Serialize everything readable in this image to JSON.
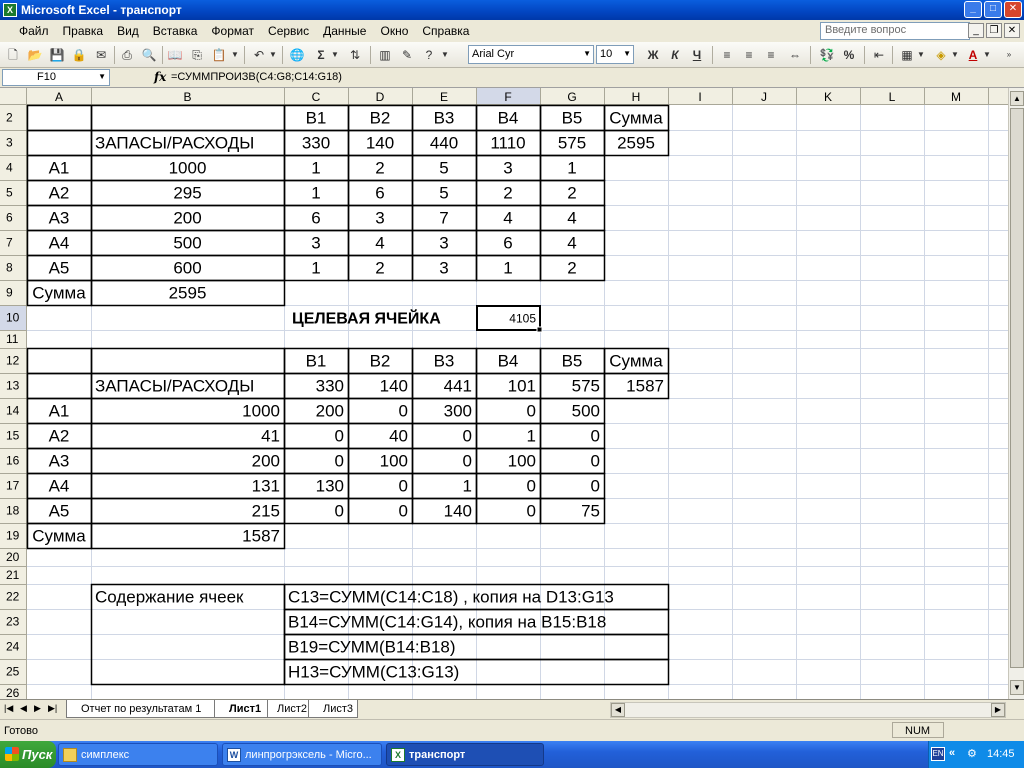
{
  "window": {
    "title": "Microsoft Excel - транспорт",
    "app_icon": "excel-icon",
    "buttons": {
      "minimize": "_",
      "maximize": "□",
      "close": "✕"
    }
  },
  "menu": {
    "items": [
      "Файл",
      "Правка",
      "Вид",
      "Вставка",
      "Формат",
      "Сервис",
      "Данные",
      "Окно",
      "Справка"
    ],
    "ask_placeholder": "Введите вопрос"
  },
  "toolbar": {
    "font_name": "Arial Cyr",
    "font_size": "10",
    "bold": "Ж",
    "italic": "К",
    "underline": "Ч"
  },
  "formula_bar": {
    "name_box": "F10",
    "fx": "fx",
    "formula": "=СУММПРОИЗВ(C4:G8;C14:G18)"
  },
  "sheet": {
    "col_headers": [
      "A",
      "B",
      "C",
      "D",
      "E",
      "F",
      "G",
      "H",
      "I",
      "J",
      "K",
      "L",
      "M"
    ],
    "row_numbers": [
      "2",
      "3",
      "4",
      "5",
      "6",
      "7",
      "8",
      "9",
      "10",
      "11",
      "12",
      "13",
      "14",
      "15",
      "16",
      "17",
      "18",
      "19",
      "20",
      "21",
      "22",
      "23",
      "24",
      "25",
      "26"
    ],
    "selected_col": "F",
    "selected_row": "10",
    "cells": [
      [
        "2",
        "C",
        "В1"
      ],
      [
        "2",
        "D",
        "В2"
      ],
      [
        "2",
        "E",
        "В3"
      ],
      [
        "2",
        "F",
        "В4"
      ],
      [
        "2",
        "G",
        "В5"
      ],
      [
        "2",
        "H",
        "Сумма"
      ],
      [
        "3",
        "B",
        "ЗАПАСЫ/РАСХОДЫ"
      ],
      [
        "3",
        "C",
        "330"
      ],
      [
        "3",
        "D",
        "140"
      ],
      [
        "3",
        "E",
        "440"
      ],
      [
        "3",
        "F",
        "1110"
      ],
      [
        "3",
        "G",
        "575"
      ],
      [
        "3",
        "H",
        "2595"
      ],
      [
        "4",
        "A",
        "А1"
      ],
      [
        "4",
        "B",
        "1000"
      ],
      [
        "4",
        "C",
        "1"
      ],
      [
        "4",
        "D",
        "2"
      ],
      [
        "4",
        "E",
        "5"
      ],
      [
        "4",
        "F",
        "3"
      ],
      [
        "4",
        "G",
        "1"
      ],
      [
        "5",
        "A",
        "А2"
      ],
      [
        "5",
        "B",
        "295"
      ],
      [
        "5",
        "C",
        "1"
      ],
      [
        "5",
        "D",
        "6"
      ],
      [
        "5",
        "E",
        "5"
      ],
      [
        "5",
        "F",
        "2"
      ],
      [
        "5",
        "G",
        "2"
      ],
      [
        "6",
        "A",
        "А3"
      ],
      [
        "6",
        "B",
        "200"
      ],
      [
        "6",
        "C",
        "6"
      ],
      [
        "6",
        "D",
        "3"
      ],
      [
        "6",
        "E",
        "7"
      ],
      [
        "6",
        "F",
        "4"
      ],
      [
        "6",
        "G",
        "4"
      ],
      [
        "7",
        "A",
        "А4"
      ],
      [
        "7",
        "B",
        "500"
      ],
      [
        "7",
        "C",
        "3"
      ],
      [
        "7",
        "D",
        "4"
      ],
      [
        "7",
        "E",
        "3"
      ],
      [
        "7",
        "F",
        "6"
      ],
      [
        "7",
        "G",
        "4"
      ],
      [
        "8",
        "A",
        "А5"
      ],
      [
        "8",
        "B",
        "600"
      ],
      [
        "8",
        "C",
        "1"
      ],
      [
        "8",
        "D",
        "2"
      ],
      [
        "8",
        "E",
        "3"
      ],
      [
        "8",
        "F",
        "1"
      ],
      [
        "8",
        "G",
        "2"
      ],
      [
        "9",
        "A",
        "Сумма"
      ],
      [
        "9",
        "B",
        "2595"
      ],
      [
        "10",
        "C",
        "ЦЕЛЕВАЯ ЯЧЕЙКА"
      ],
      [
        "10",
        "F",
        "4105"
      ],
      [
        "12",
        "C",
        "В1"
      ],
      [
        "12",
        "D",
        "В2"
      ],
      [
        "12",
        "E",
        "В3"
      ],
      [
        "12",
        "F",
        "В4"
      ],
      [
        "12",
        "G",
        "В5"
      ],
      [
        "12",
        "H",
        "Сумма"
      ],
      [
        "13",
        "B",
        "ЗАПАСЫ/РАСХОДЫ"
      ],
      [
        "13",
        "C",
        "330"
      ],
      [
        "13",
        "D",
        "140"
      ],
      [
        "13",
        "E",
        "441"
      ],
      [
        "13",
        "F",
        "101"
      ],
      [
        "13",
        "G",
        "575"
      ],
      [
        "13",
        "H",
        "1587"
      ],
      [
        "14",
        "A",
        "А1"
      ],
      [
        "14",
        "B",
        "1000"
      ],
      [
        "14",
        "C",
        "200"
      ],
      [
        "14",
        "D",
        "0"
      ],
      [
        "14",
        "E",
        "300"
      ],
      [
        "14",
        "F",
        "0"
      ],
      [
        "14",
        "G",
        "500"
      ],
      [
        "15",
        "A",
        "А2"
      ],
      [
        "15",
        "B",
        "41"
      ],
      [
        "15",
        "C",
        "0"
      ],
      [
        "15",
        "D",
        "40"
      ],
      [
        "15",
        "E",
        "0"
      ],
      [
        "15",
        "F",
        "1"
      ],
      [
        "15",
        "G",
        "0"
      ],
      [
        "16",
        "A",
        "А3"
      ],
      [
        "16",
        "B",
        "200"
      ],
      [
        "16",
        "C",
        "0"
      ],
      [
        "16",
        "D",
        "100"
      ],
      [
        "16",
        "E",
        "0"
      ],
      [
        "16",
        "F",
        "100"
      ],
      [
        "16",
        "G",
        "0"
      ],
      [
        "17",
        "A",
        "А4"
      ],
      [
        "17",
        "B",
        "131"
      ],
      [
        "17",
        "C",
        "130"
      ],
      [
        "17",
        "D",
        "0"
      ],
      [
        "17",
        "E",
        "1"
      ],
      [
        "17",
        "F",
        "0"
      ],
      [
        "17",
        "G",
        "0"
      ],
      [
        "18",
        "A",
        "А5"
      ],
      [
        "18",
        "B",
        "215"
      ],
      [
        "18",
        "C",
        "0"
      ],
      [
        "18",
        "D",
        "0"
      ],
      [
        "18",
        "E",
        "140"
      ],
      [
        "18",
        "F",
        "0"
      ],
      [
        "18",
        "G",
        "75"
      ],
      [
        "19",
        "A",
        "Сумма"
      ],
      [
        "19",
        "B",
        "1587"
      ],
      [
        "22",
        "B",
        "Содержание ячеек"
      ],
      [
        "22",
        "C",
        "C13=СУММ(C14:C18) , копия на D13:G13"
      ],
      [
        "23",
        "C",
        "B14=СУММ(C14:G14), копия на B15:B18"
      ],
      [
        "24",
        "C",
        "B19=СУММ(B14:B18)"
      ],
      [
        "25",
        "C",
        "H13=СУММ(C13:G13)"
      ]
    ]
  },
  "sheet_tabs": [
    "Отчет по результатам 1",
    "Лист1",
    "Лист2",
    "Лист3"
  ],
  "active_tab": "Лист1",
  "status": {
    "ready": "Готово",
    "num": "NUM"
  },
  "taskbar": {
    "start": "Пуск",
    "tasks": [
      "симплекс",
      "линпрогрэксель - Micro...",
      "транспорт"
    ],
    "active_task": "транспорт",
    "lang": "EN",
    "chevron": "«",
    "time": "14:45"
  }
}
